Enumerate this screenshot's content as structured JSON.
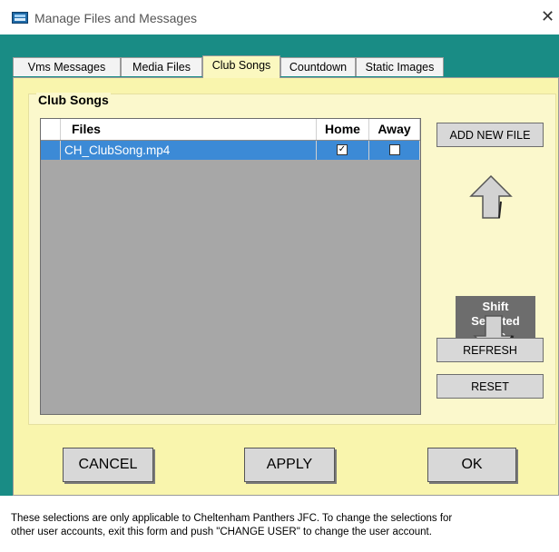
{
  "window": {
    "title": "Manage Files and Messages",
    "close_glyph": "✕"
  },
  "tabs": [
    {
      "label": "Vms Messages",
      "active": false
    },
    {
      "label": "Media Files",
      "active": false
    },
    {
      "label": "Club Songs",
      "active": true
    },
    {
      "label": "Countdown",
      "active": false
    },
    {
      "label": "Static Images",
      "active": false
    }
  ],
  "group": {
    "title": "Club Songs"
  },
  "grid": {
    "columns": [
      "Files",
      "Home",
      "Away"
    ],
    "rows": [
      {
        "file": "CH_ClubSong.mp4",
        "home": true,
        "away": false,
        "selected": true
      }
    ]
  },
  "side_buttons": {
    "add_new_file": "ADD NEW FILE",
    "shift_label_line1": "Shift",
    "shift_label_line2": "Selected",
    "shift_label_line3": "File",
    "refresh": "REFRESH",
    "reset": "RESET"
  },
  "bottom_buttons": {
    "cancel": "CANCEL",
    "apply": "APPLY",
    "ok": "OK"
  },
  "footer": {
    "line1": "These selections are only applicable to Cheltenham Panthers JFC. To change the selections for",
    "line2": "other user accounts, exit this form and push \"CHANGE USER\" to change the user account."
  },
  "colors": {
    "teal_background": "#198c85",
    "panel_yellow": "#f9f5ad",
    "selection_blue": "#3c8ad6",
    "grid_gray": "#a7a7a7"
  }
}
